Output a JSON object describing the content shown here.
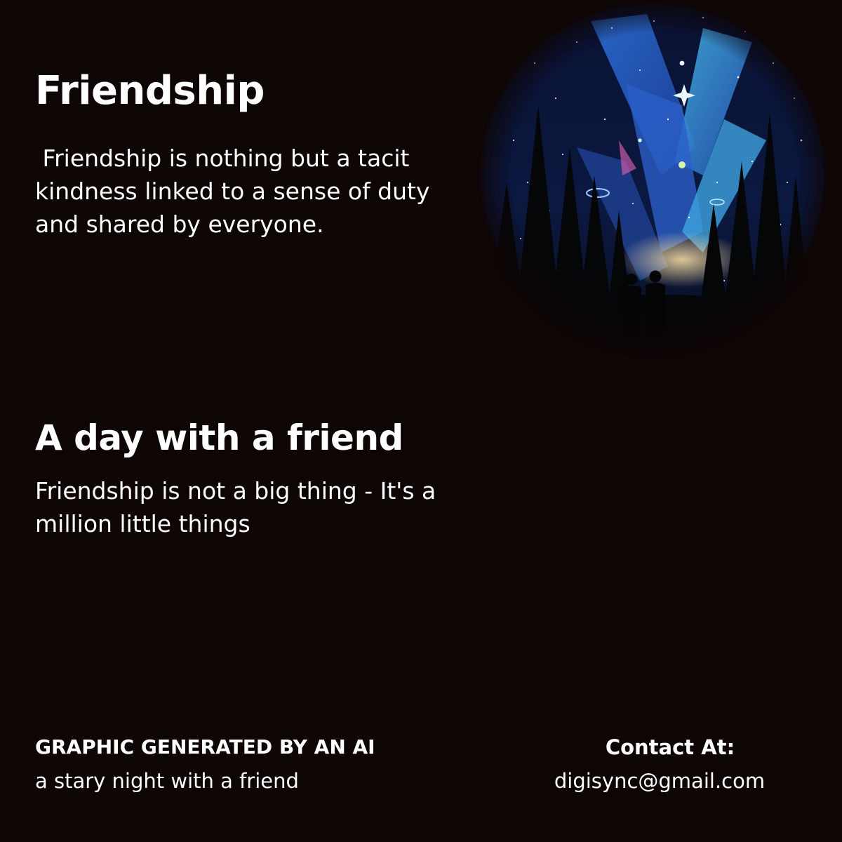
{
  "heading": "Friendship",
  "heading_text": " Friendship is nothing but a tacit kindness linked to a sense of duty and shared by everyone.",
  "subheading": "A day with a friend",
  "subheading_text": "Friendship is not a big thing - It's a million little things",
  "footer": {
    "credit_heading": "GRAPHIC GENERATED BY AN AI",
    "credit_caption": "a stary night with a friend",
    "contact_heading": "Contact At:",
    "contact_email": "digisync@gmail.com"
  },
  "colors": {
    "background": "#0e0505",
    "text": "#ffffff",
    "sky_blue": "#2b6fd6",
    "sky_cyan": "#46b8e8",
    "sky_glow": "#f3d9a0"
  },
  "artwork": {
    "subject": "two-silhouettes-under-starry-sky"
  }
}
